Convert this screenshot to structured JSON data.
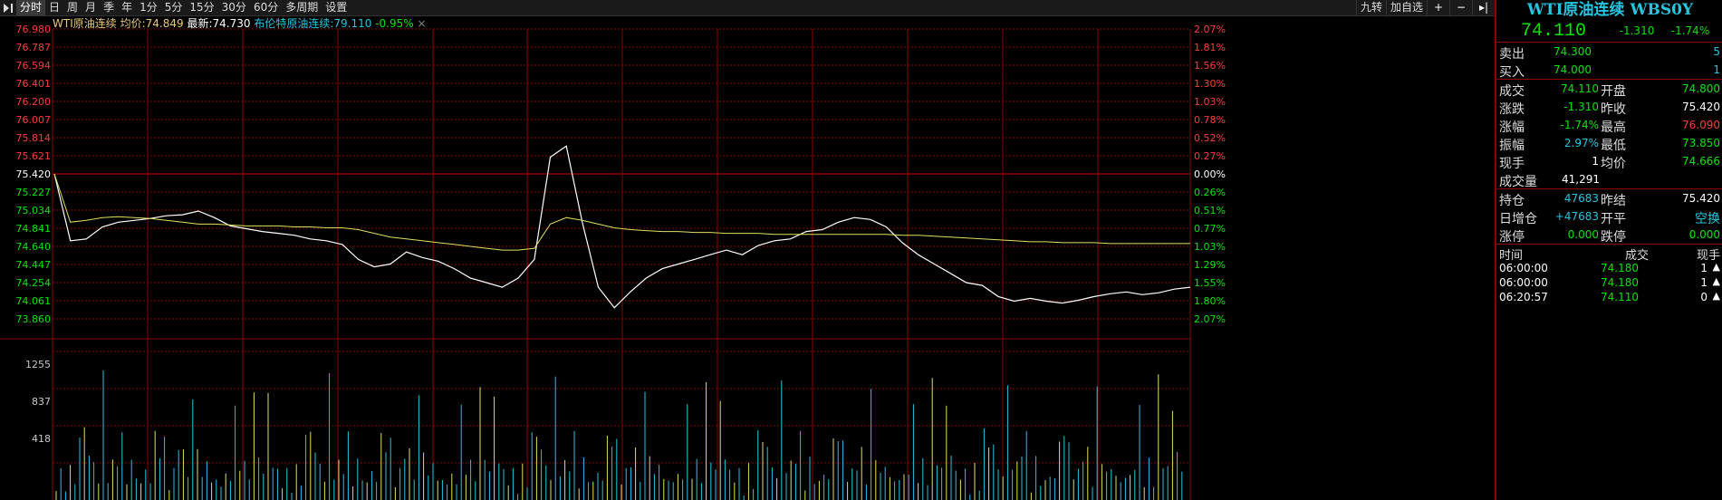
{
  "toolbar": {
    "tabs": [
      "分时",
      "日",
      "周",
      "月",
      "季",
      "年",
      "1分",
      "5分",
      "15分",
      "30分",
      "60分",
      "多周期",
      "设置"
    ],
    "active_tab": "分时",
    "right_buttons": [
      "九转",
      "加自选"
    ]
  },
  "header_info": {
    "name": "WTI原油连续",
    "avg_label": "均价:",
    "avg_value": "74.849",
    "last_label": "最新:",
    "last_value": "74.730",
    "compare_name": "布伦特原油连续:",
    "compare_value": "79.110",
    "compare_pct": "-0.95%",
    "close_symbol": "×"
  },
  "chart_data": {
    "type": "line",
    "price_axis_left": [
      "76.980",
      "76.787",
      "76.594",
      "76.401",
      "76.200",
      "76.007",
      "75.814",
      "75.621",
      "75.420",
      "75.227",
      "75.034",
      "74.841",
      "74.640",
      "74.447",
      "74.254",
      "74.061",
      "73.860"
    ],
    "pct_axis_right": [
      "2.07%",
      "1.81%",
      "1.56%",
      "1.30%",
      "1.03%",
      "0.78%",
      "0.52%",
      "0.27%",
      "0.00%",
      "0.26%",
      "0.51%",
      "0.77%",
      "1.03%",
      "1.29%",
      "1.55%",
      "1.80%",
      "2.07%"
    ],
    "prev_close": 75.42,
    "volume_axis": [
      "1255",
      "837",
      "418"
    ],
    "ylim": [
      73.86,
      76.98
    ],
    "series": [
      {
        "name": "WTI原油连续",
        "color": "#ffffff",
        "values": [
          75.42,
          74.7,
          74.72,
          74.85,
          74.9,
          74.92,
          74.94,
          74.97,
          74.98,
          75.02,
          74.95,
          74.86,
          74.83,
          74.8,
          74.78,
          74.76,
          74.72,
          74.7,
          74.66,
          74.5,
          74.42,
          74.45,
          74.58,
          74.52,
          74.48,
          74.4,
          74.3,
          74.25,
          74.2,
          74.3,
          74.5,
          75.6,
          75.72,
          74.9,
          74.2,
          73.98,
          74.15,
          74.3,
          74.4,
          74.45,
          74.5,
          74.55,
          74.6,
          74.55,
          74.65,
          74.7,
          74.72,
          74.8,
          74.82,
          74.9,
          74.95,
          74.93,
          74.85,
          74.68,
          74.55,
          74.45,
          74.35,
          74.25,
          74.22,
          74.1,
          74.05,
          74.08,
          74.05,
          74.03,
          74.06,
          74.1,
          74.13,
          74.15,
          74.12,
          74.14,
          74.18,
          74.2
        ]
      },
      {
        "name": "均价",
        "color": "#e0e060",
        "values": [
          75.42,
          74.9,
          74.92,
          74.95,
          74.96,
          74.95,
          74.94,
          74.92,
          74.9,
          74.88,
          74.88,
          74.87,
          74.86,
          74.86,
          74.86,
          74.85,
          74.85,
          74.84,
          74.84,
          74.82,
          74.78,
          74.74,
          74.72,
          74.7,
          74.68,
          74.66,
          74.64,
          74.62,
          74.6,
          74.6,
          74.62,
          74.88,
          74.95,
          74.92,
          74.88,
          74.84,
          74.82,
          74.81,
          74.8,
          74.8,
          74.79,
          74.79,
          74.78,
          74.78,
          74.78,
          74.77,
          74.77,
          74.77,
          74.77,
          74.77,
          74.77,
          74.77,
          74.77,
          74.76,
          74.76,
          74.75,
          74.74,
          74.73,
          74.72,
          74.71,
          74.7,
          74.69,
          74.69,
          74.68,
          74.68,
          74.68,
          74.67,
          74.67,
          74.67,
          74.67,
          74.67,
          74.67
        ]
      }
    ],
    "volume_peaks": [
      418,
      300,
      200,
      350,
      250,
      700,
      900,
      600,
      400,
      300,
      1255,
      500,
      380,
      1100,
      650,
      300
    ]
  },
  "quote_panel": {
    "title": "WTI原油连续 WBS0Y",
    "last": "74.110",
    "change": "-1.310",
    "change_pct": "-1.74%",
    "ask_label": "卖出",
    "ask_price": "74.300",
    "ask_vol": "5",
    "bid_label": "买入",
    "bid_price": "74.000",
    "bid_vol": "1",
    "rows": [
      {
        "l1": "成交",
        "v1": "74.110",
        "c1": "g",
        "l2": "开盘",
        "v2": "74.800",
        "c2": "g"
      },
      {
        "l1": "涨跌",
        "v1": "-1.310",
        "c1": "g",
        "l2": "昨收",
        "v2": "75.420",
        "c2": "w"
      },
      {
        "l1": "涨幅",
        "v1": "-1.74%",
        "c1": "g",
        "l2": "最高",
        "v2": "76.090",
        "c2": "r"
      },
      {
        "l1": "振幅",
        "v1": "2.97%",
        "c1": "c",
        "l2": "最低",
        "v2": "73.850",
        "c2": "g"
      },
      {
        "l1": "现手",
        "v1": "1",
        "c1": "w",
        "l2": "均价",
        "v2": "74.666",
        "c2": "g"
      }
    ],
    "volume_label": "成交量",
    "volume_value": "41,291",
    "oi_label": "持仓",
    "oi_value": "47683",
    "prev_settle_label": "昨结",
    "prev_settle_value": "75.420",
    "oi_change_label": "日增仓",
    "oi_change_value": "+47683",
    "open_close_label": "开平",
    "open_close_value": "空换",
    "limit_up_label": "涨停",
    "limit_up_value": "0.000",
    "limit_down_label": "跌停",
    "limit_down_value": "0.000",
    "trades_header": {
      "time": "时间",
      "price": "成交",
      "qty": "现手"
    },
    "trades": [
      {
        "time": "06:00:00",
        "price": "74.180",
        "qty": "1",
        "arrow": "up"
      },
      {
        "time": "06:00:00",
        "price": "74.180",
        "qty": "1",
        "arrow": "up"
      },
      {
        "time": "06:20:57",
        "price": "74.110",
        "qty": "0",
        "arrow": "up"
      }
    ]
  },
  "colors": {
    "grid": "#8b0000",
    "price_up": "#ff3b3b",
    "price_down": "#00e600",
    "accent": "#25c5e0"
  }
}
